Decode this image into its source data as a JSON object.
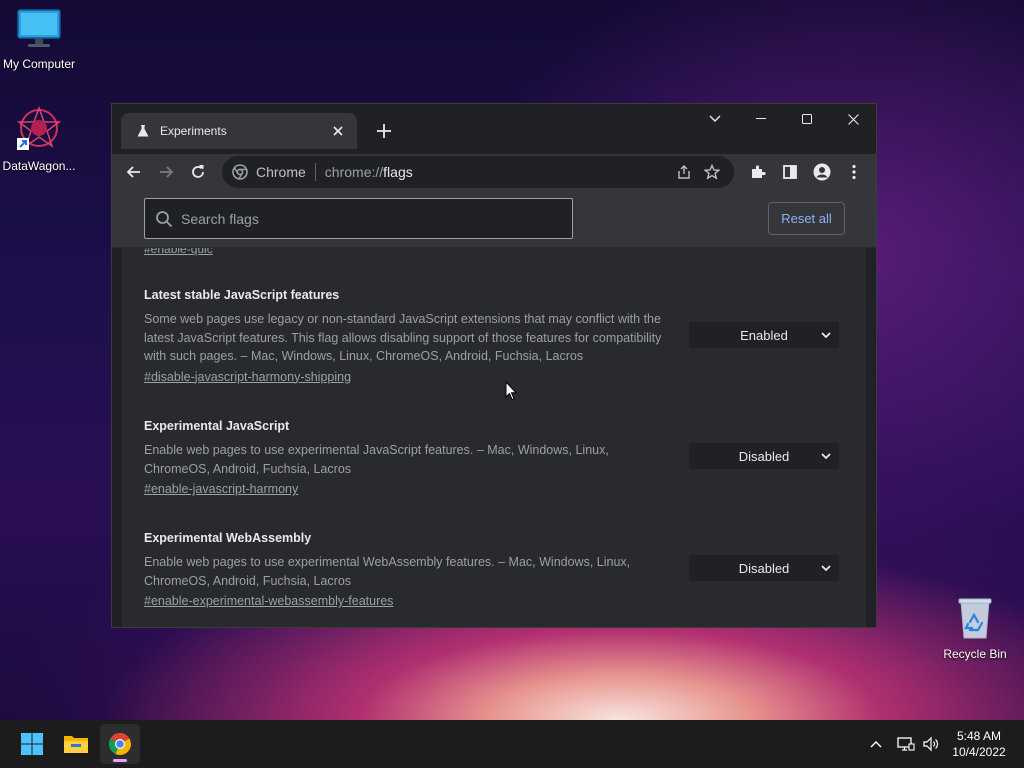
{
  "desktop": {
    "icons": [
      {
        "label": "My Computer"
      },
      {
        "label": "DataWagon..."
      },
      {
        "label": "Recycle Bin"
      }
    ]
  },
  "browser": {
    "tab": {
      "title": "Experiments"
    },
    "omnibox": {
      "site": "Chrome",
      "scheme": "chrome://",
      "host": "flags"
    }
  },
  "flags_page": {
    "search_placeholder": "Search flags",
    "reset_label": "Reset all",
    "cut_link": "#enable-quic",
    "flags": [
      {
        "title": "Latest stable JavaScript features",
        "description": "Some web pages use legacy or non-standard JavaScript extensions that may conflict with the latest JavaScript features. This flag allows disabling support of those features for compatibility with such pages. – Mac, Windows, Linux, ChromeOS, Android, Fuchsia, Lacros",
        "link": "#disable-javascript-harmony-shipping",
        "value": "Enabled"
      },
      {
        "title": "Experimental JavaScript",
        "description": "Enable web pages to use experimental JavaScript features. – Mac, Windows, Linux, ChromeOS, Android, Fuchsia, Lacros",
        "link": "#enable-javascript-harmony",
        "value": "Disabled"
      },
      {
        "title": "Experimental WebAssembly",
        "description": "Enable web pages to use experimental WebAssembly features. – Mac, Windows, Linux, ChromeOS, Android, Fuchsia, Lacros",
        "link": "#enable-experimental-webassembly-features",
        "value": "Disabled"
      }
    ]
  },
  "taskbar": {
    "time": "5:48 AM",
    "date": "10/4/2022"
  }
}
